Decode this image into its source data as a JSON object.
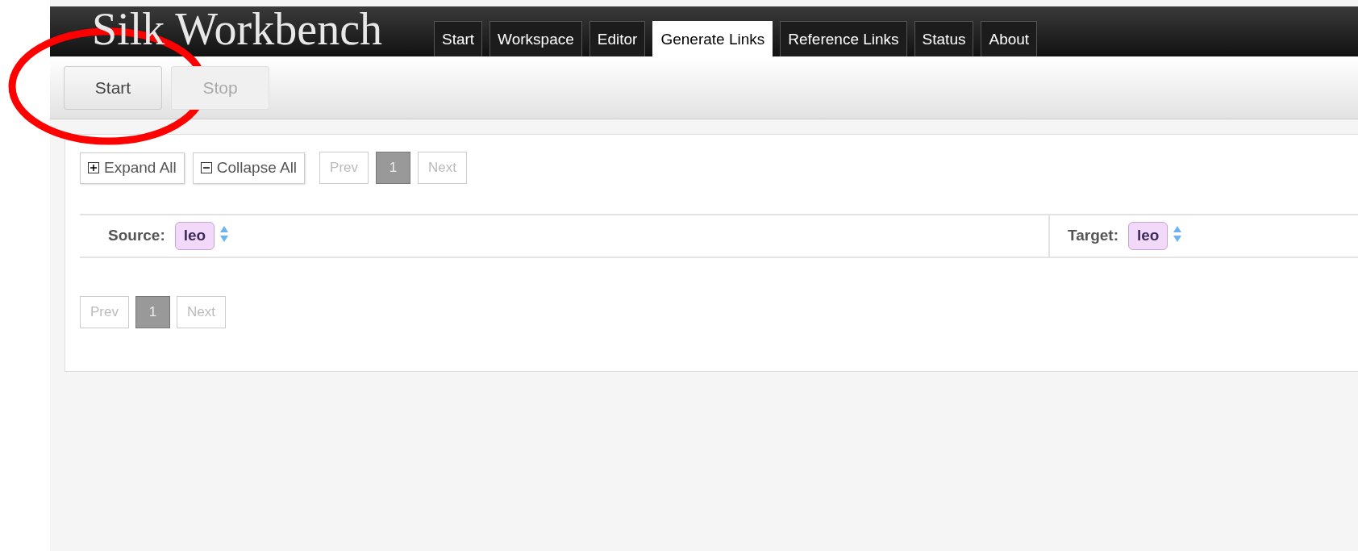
{
  "header": {
    "title": "Silk Workbench",
    "tabs": [
      {
        "label": "Start",
        "selected": false
      },
      {
        "label": "Workspace",
        "selected": false
      },
      {
        "label": "Editor",
        "selected": false
      },
      {
        "label": "Generate Links",
        "selected": true
      },
      {
        "label": "Reference Links",
        "selected": false
      },
      {
        "label": "Status",
        "selected": false
      },
      {
        "label": "About",
        "selected": false
      }
    ]
  },
  "toolbar": {
    "buttons": [
      {
        "label": "Start",
        "disabled": false
      },
      {
        "label": "Stop",
        "disabled": true
      }
    ]
  },
  "tree_controls": [
    {
      "kind": "expand",
      "label": "Expand All"
    },
    {
      "kind": "collapse",
      "label": "Collapse All"
    }
  ],
  "pager_top": {
    "prev": {
      "label": "Prev",
      "disabled": true
    },
    "pages": [
      {
        "label": "1",
        "selected": true
      }
    ],
    "next": {
      "label": "Next",
      "disabled": true
    }
  },
  "table": {
    "columns": [
      {
        "label": "Source:",
        "tag": "leo"
      },
      {
        "label": "Target:",
        "tag": "leo"
      }
    ]
  },
  "pager_bottom": {
    "prev": {
      "label": "Prev",
      "disabled": true
    },
    "pages": [
      {
        "label": "1",
        "selected": true
      }
    ],
    "next": {
      "label": "Next",
      "disabled": true
    }
  },
  "annotation": {
    "kind": "ellipse"
  }
}
